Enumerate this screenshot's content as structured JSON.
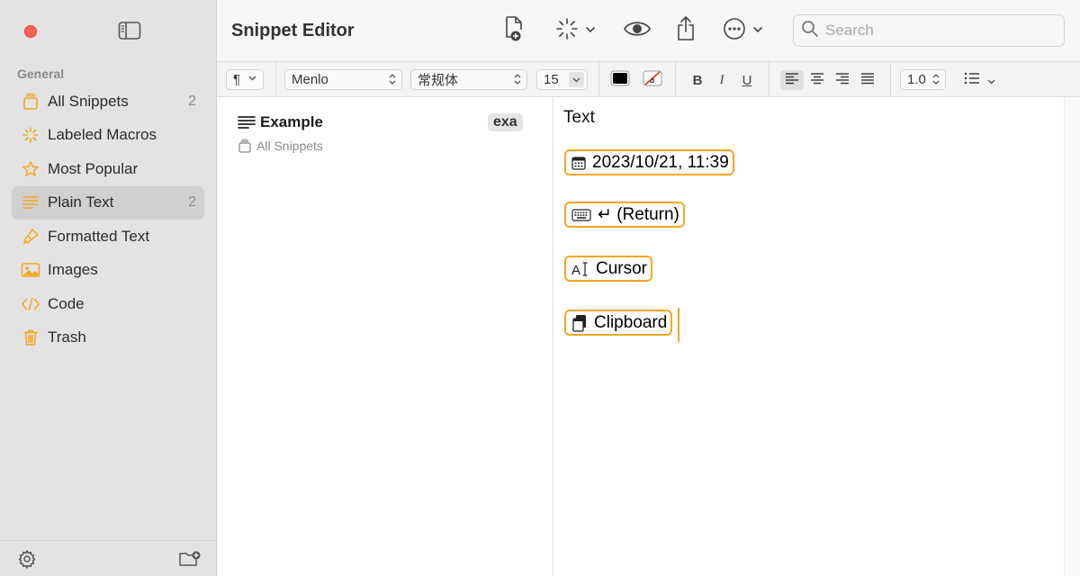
{
  "app": {
    "title": "Snippet Editor"
  },
  "sidebar": {
    "section": "General",
    "items": [
      {
        "label": "All Snippets",
        "icon": "tray-icon",
        "count": "2"
      },
      {
        "label": "Labeled Macros",
        "icon": "sparkle-icon",
        "count": ""
      },
      {
        "label": "Most Popular",
        "icon": "star-icon",
        "count": ""
      },
      {
        "label": "Plain Text",
        "icon": "text-lines-icon",
        "count": "2",
        "selected": true
      },
      {
        "label": "Formatted Text",
        "icon": "brush-icon",
        "count": ""
      },
      {
        "label": "Images",
        "icon": "photo-icon",
        "count": ""
      },
      {
        "label": "Code",
        "icon": "code-icon",
        "count": ""
      },
      {
        "label": "Trash",
        "icon": "trash-icon",
        "count": ""
      }
    ],
    "accent": "#f5a623"
  },
  "toolbar": {
    "search_placeholder": "Search"
  },
  "formatbar": {
    "paragraph": "¶",
    "font": "Menlo",
    "style": "常规体",
    "size": "15",
    "bold": "B",
    "italic": "I",
    "underline": "U",
    "line_spacing": "1.0"
  },
  "snippet_list": [
    {
      "title": "Example",
      "abbreviation": "exa",
      "folder": "All Snippets"
    }
  ],
  "editor": {
    "text": "Text",
    "tokens": [
      {
        "kind": "date",
        "label": "2023/10/21, 11:39",
        "icon": "calendar-icon"
      },
      {
        "kind": "key",
        "label": "↵ (Return)",
        "icon": "keyboard-icon"
      },
      {
        "kind": "cursor",
        "label": "Cursor",
        "icon": "cursor-icon"
      },
      {
        "kind": "clipboard",
        "label": "Clipboard",
        "icon": "clipboard-icon"
      }
    ]
  }
}
